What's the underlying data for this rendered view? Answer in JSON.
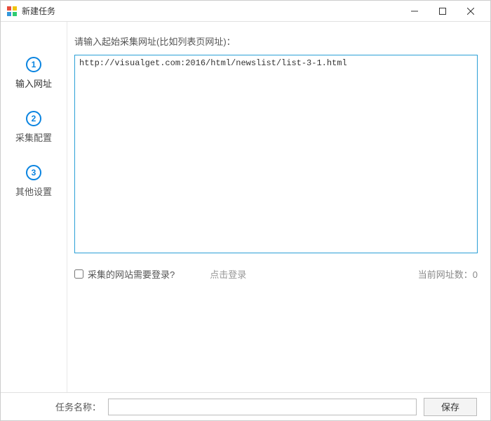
{
  "window": {
    "title": "新建任务"
  },
  "sidebar": {
    "items": [
      {
        "num": "1",
        "label": "输入网址"
      },
      {
        "num": "2",
        "label": "采集配置"
      },
      {
        "num": "3",
        "label": "其他设置"
      }
    ]
  },
  "main": {
    "prompt": "请输入起始采集网址(比如列表页网址)：",
    "url_value": "http://visualget.com:2016/html/newslist/list-3-1.html",
    "login_checkbox_label": "采集的网站需要登录?",
    "login_link": "点击登录",
    "url_count_label": "当前网址数：0"
  },
  "footer": {
    "task_label": "任务名称：",
    "task_value": "",
    "save_label": "保存"
  }
}
